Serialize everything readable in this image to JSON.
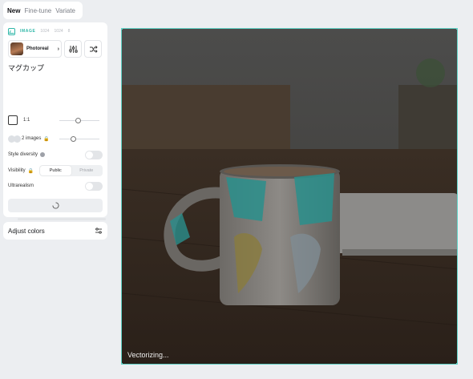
{
  "tabs": [
    "New",
    "Fine-tune",
    "Variate"
  ],
  "mode": {
    "label": "IMAGE",
    "width": "1024",
    "height": "1024",
    "count": "8"
  },
  "model": {
    "name": "Photoreal"
  },
  "prompt": "マグカップ",
  "aspect": {
    "label": "1:1"
  },
  "images": {
    "label": "2 images"
  },
  "style_diversity": {
    "label": "Style diversity",
    "enabled": false
  },
  "visibility": {
    "label": "Visibility",
    "options": [
      "Public",
      "Private"
    ],
    "selected": "Public"
  },
  "ultrarealism": {
    "label": "Ultrarealism",
    "enabled": false
  },
  "adjust_colors": {
    "label": "Adjust colors"
  },
  "canvas": {
    "status": "Vectorizing..."
  },
  "colors": {
    "accent": "#2fb7a8",
    "border": "#5ed0c4"
  }
}
